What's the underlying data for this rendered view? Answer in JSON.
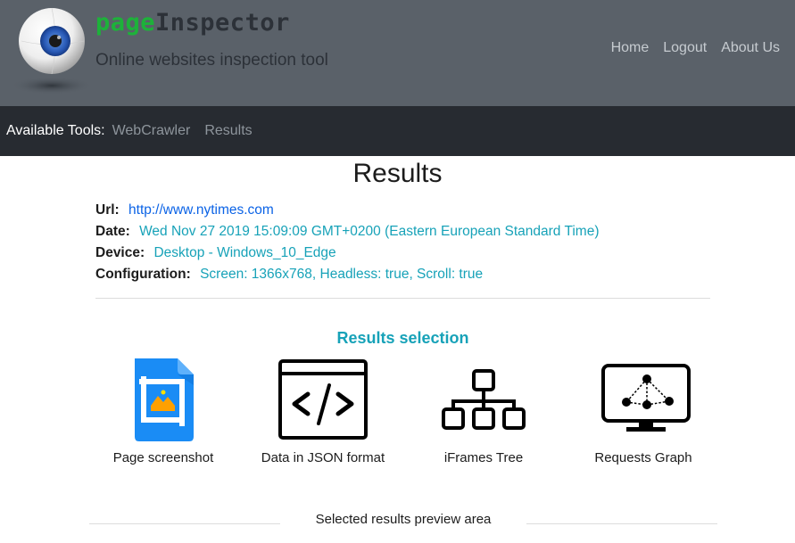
{
  "header": {
    "brand_part1": "page",
    "brand_part2": "Inspector",
    "subtitle": "Online websites inspection tool",
    "logo_icon": "eyeball-icon",
    "nav": [
      {
        "label": "Home"
      },
      {
        "label": "Logout"
      },
      {
        "label": "About Us"
      }
    ]
  },
  "toolbar": {
    "label": "Available Tools:",
    "items": [
      {
        "label": "WebCrawler"
      },
      {
        "label": "Results"
      }
    ]
  },
  "main": {
    "title": "Results",
    "info": {
      "url_key": "Url:",
      "url_value": "http://www.nytimes.com",
      "date_key": "Date:",
      "date_value": "Wed Nov 27 2019 15:09:09 GMT+0200 (Eastern European Standard Time)",
      "device_key": "Device:",
      "device_value": "Desktop - Windows_10_Edge",
      "config_key": "Configuration:",
      "config_value": "Screen: 1366x768, Headless: true, Scroll: true"
    },
    "selection_title": "Results selection",
    "tools": [
      {
        "label": "Page screenshot",
        "icon": "screenshot-icon"
      },
      {
        "label": "Data in JSON format",
        "icon": "code-window-icon"
      },
      {
        "label": "iFrames Tree",
        "icon": "tree-hierarchy-icon"
      },
      {
        "label": "Requests Graph",
        "icon": "monitor-graph-icon"
      }
    ],
    "preview_label": "Selected results preview area"
  },
  "colors": {
    "header_bg": "#5a6169",
    "toolbar_bg": "#272b31",
    "brand_green": "#1db23a",
    "accent_teal": "#17a2b8",
    "link_blue": "#0b63e6"
  }
}
